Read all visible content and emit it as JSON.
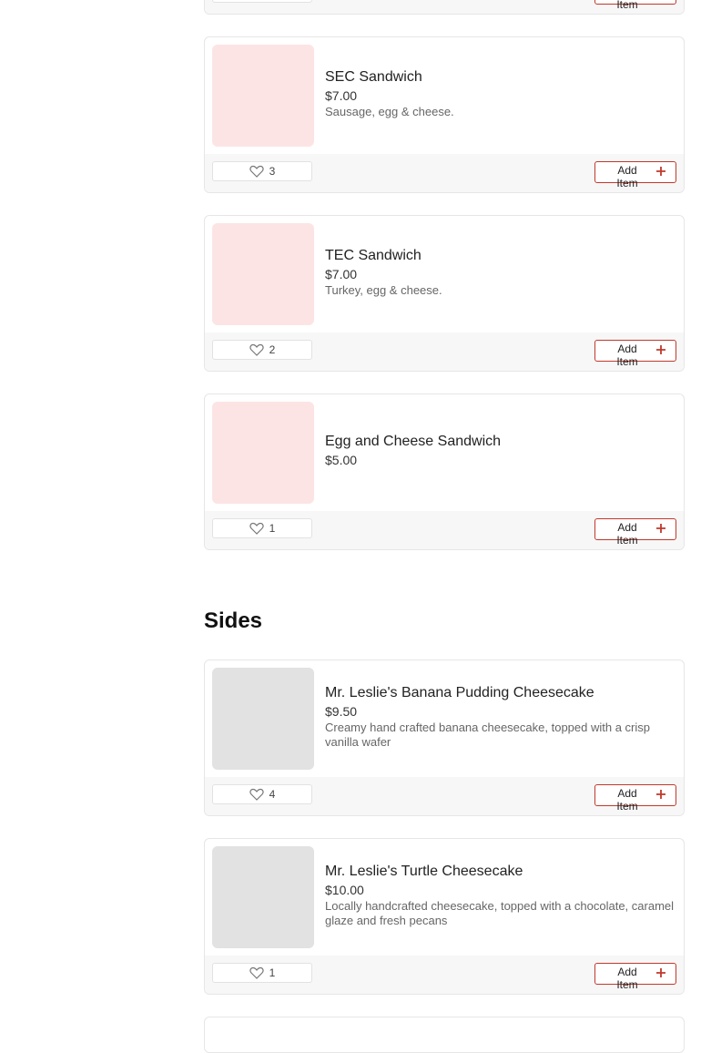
{
  "colors": {
    "accent": "#c0392b",
    "placeholder_pink": "#fde4e4",
    "placeholder_gray": "#e2e2e2"
  },
  "top_partial": {
    "add_label": "Add Item"
  },
  "breakfast_items": [
    {
      "name": "SEC Sandwich",
      "price": "$7.00",
      "description": "Sausage, egg & cheese.",
      "likes": "3",
      "add_label": "Add Item"
    },
    {
      "name": "TEC Sandwich",
      "price": "$7.00",
      "description": "Turkey, egg & cheese.",
      "likes": "2",
      "add_label": "Add Item"
    },
    {
      "name": "Egg and Cheese Sandwich",
      "price": "$5.00",
      "likes": "1",
      "add_label": "Add Item"
    }
  ],
  "sides": {
    "title": "Sides",
    "items": [
      {
        "name": "Mr. Leslie's Banana Pudding Cheesecake",
        "price": "$9.50",
        "description": "Creamy hand crafted banana cheesecake, topped with a crisp vanilla wafer",
        "likes": "4",
        "add_label": "Add Item"
      },
      {
        "name": "Mr. Leslie's Turtle Cheesecake",
        "price": "$10.00",
        "description": "Locally handcrafted cheesecake, topped with a chocolate, caramel glaze and fresh pecans",
        "likes": "1",
        "add_label": "Add Item"
      }
    ]
  },
  "icons": {
    "like": "heart-icon",
    "add": "plus-icon"
  }
}
